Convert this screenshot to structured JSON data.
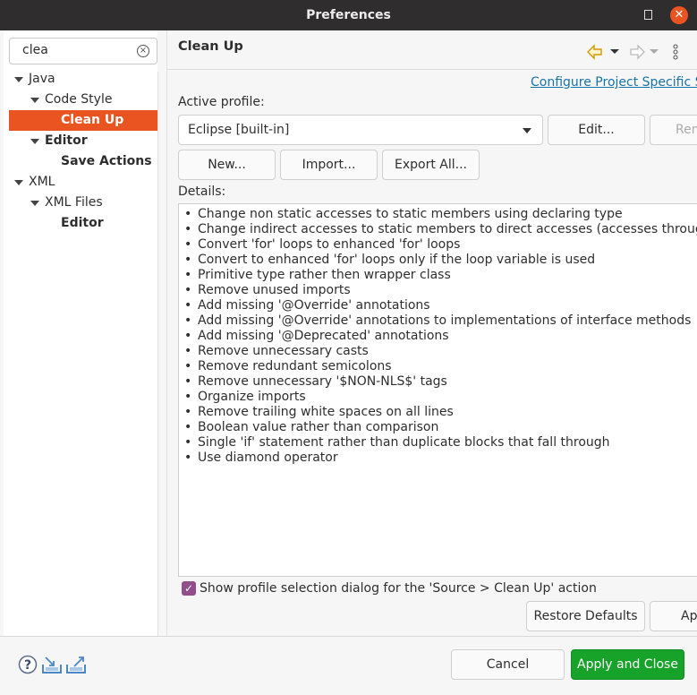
{
  "window": {
    "title": "Preferences",
    "maximize_icon": "maximize-icon",
    "close_icon": "close-icon",
    "close_glyph": "✕"
  },
  "sidebar": {
    "filter_value": "clea",
    "clear_glyph": "×",
    "tree": [
      {
        "label": "Java",
        "level": 0,
        "expanded": true,
        "bold": false
      },
      {
        "label": "Code Style",
        "level": 1,
        "expanded": true,
        "bold": false
      },
      {
        "label": "Clean Up",
        "level": 2,
        "selected": true,
        "bold": true
      },
      {
        "label": "Editor",
        "level": 1,
        "expanded": true,
        "bold": true
      },
      {
        "label": "Save Actions",
        "level": 2,
        "bold": true
      },
      {
        "label": "XML",
        "level": 0,
        "expanded": true,
        "bold": false
      },
      {
        "label": "XML Files",
        "level": 1,
        "expanded": true,
        "bold": false
      },
      {
        "label": "Editor",
        "level": 2,
        "bold": true
      }
    ]
  },
  "page": {
    "title": "Clean Up",
    "configure_link": "Configure Project Specific Settings...",
    "active_profile_label": "Active profile:",
    "active_profile_value": "Eclipse [built-in]",
    "buttons": {
      "edit": "Edit...",
      "remove": "Remove",
      "new": "New...",
      "import": "Import...",
      "export_all": "Export All..."
    },
    "details_label": "Details:",
    "details": [
      "Change non static accesses to static members using declaring type",
      "Change indirect accesses to static members to direct accesses (accesses through subtypes)",
      "Convert 'for' loops to enhanced 'for' loops",
      "Convert to enhanced 'for' loops only if the loop variable is used",
      "Primitive type rather then wrapper class",
      "Remove unused imports",
      "Add missing '@Override' annotations",
      "Add missing '@Override' annotations to implementations of interface methods",
      "Add missing '@Deprecated' annotations",
      "Remove unnecessary casts",
      "Remove redundant semicolons",
      "Remove unnecessary '$NON-NLS$' tags",
      "Organize imports",
      "Remove trailing white spaces on all lines",
      "Boolean value rather than comparison",
      "Single 'if' statement rather than duplicate blocks that fall through",
      "Use diamond operator"
    ],
    "show_dialog_checkbox": {
      "label": "Show profile selection dialog for the 'Source > Clean Up' action",
      "checked": true
    },
    "restore_defaults": "Restore Defaults",
    "apply": "Apply"
  },
  "footer": {
    "cancel": "Cancel",
    "apply_and_close": "Apply and Close"
  },
  "colors": {
    "selection": "#e95420",
    "primary_button": "#17a32a",
    "link": "#1874a8",
    "checkbox": "#924d8b"
  }
}
